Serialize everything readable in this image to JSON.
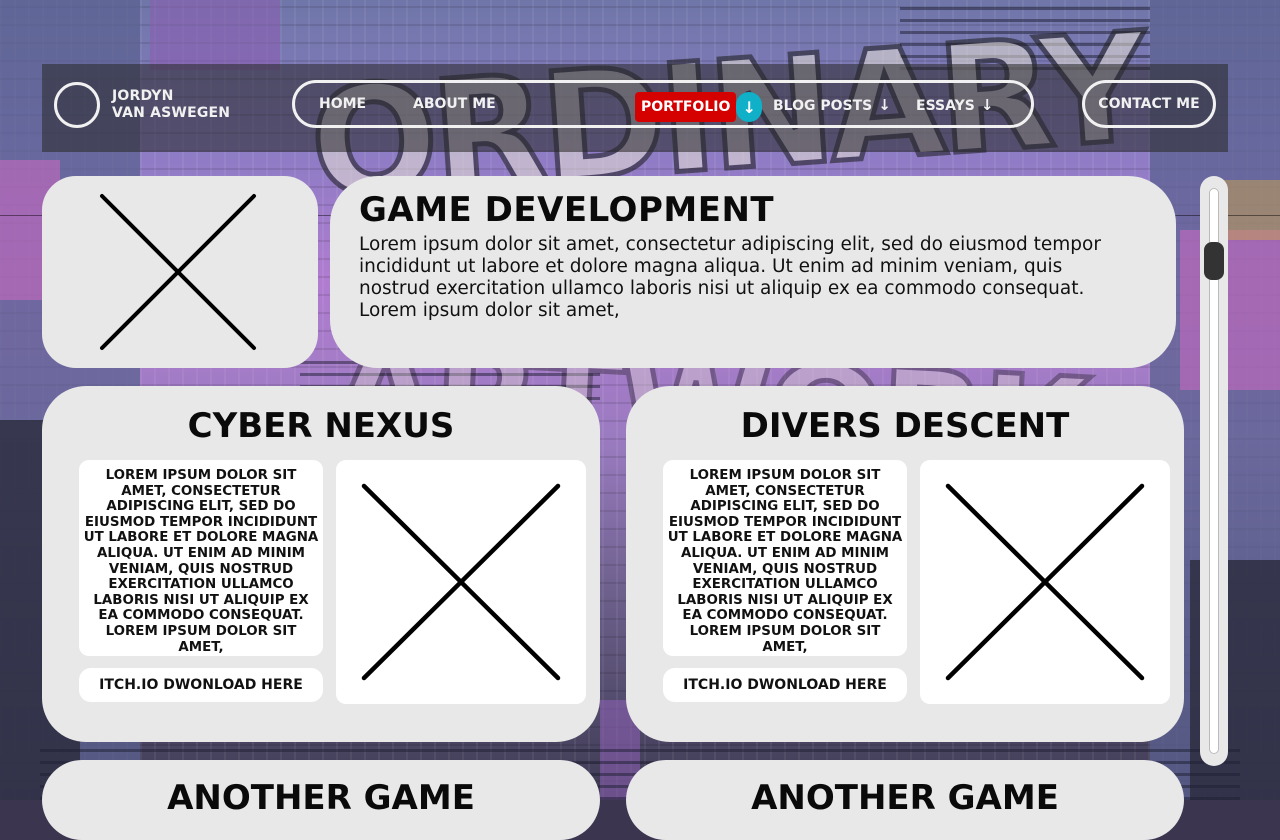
{
  "brand": {
    "name_line1": "JORDYN",
    "name_line2": "VAN ASWEGEN"
  },
  "nav": {
    "home": "HOME",
    "about": "ABOUT ME",
    "portfolio": "PORTFOLIO",
    "portfolio_arrow": "↓",
    "blog": "BLOG POSTS",
    "blog_arrow": "↓",
    "essays": "ESSAYS",
    "essays_arrow": "↓",
    "contact": "CONTACT ME",
    "active_color": "#d50000",
    "arrow_badge_color": "#0fb0c8"
  },
  "section": {
    "title": "GAME DEVELOPMENT",
    "body": "Lorem ipsum dolor sit amet, consectetur adipiscing elit, sed do eiusmod tempor incididunt ut labore et dolore magna aliqua. Ut enim ad minim veniam, quis nostrud exercitation ullamco laboris nisi ut aliquip ex ea commodo consequat. Lorem ipsum dolor sit amet,",
    "image_icon": "placeholder-x-icon"
  },
  "games": [
    {
      "title": "CYBER NEXUS",
      "description": "LOREM IPSUM DOLOR SIT AMET, CONSECTETUR ADIPISCING ELIT, SED DO EIUSMOD TEMPOR INCIDIDUNT UT LABORE ET DOLORE MAGNA ALIQUA. UT ENIM AD MINIM VENIAM, QUIS NOSTRUD EXERCITATION ULLAMCO LABORIS NISI UT ALIQUIP EX EA COMMODO CONSEQUAT. LOREM IPSUM DOLOR SIT AMET,",
      "link": "ITCH.IO DWONLOAD HERE"
    },
    {
      "title": "DIVERS DESCENT",
      "description": "LOREM IPSUM DOLOR SIT AMET, CONSECTETUR ADIPISCING ELIT, SED DO EIUSMOD TEMPOR INCIDIDUNT UT LABORE ET DOLORE MAGNA ALIQUA. UT ENIM AD MINIM VENIAM, QUIS NOSTRUD EXERCITATION ULLAMCO LABORIS NISI UT ALIQUIP EX EA COMMODO CONSEQUAT. LOREM IPSUM DOLOR SIT AMET,",
      "link": "ITCH.IO DWONLOAD HERE"
    }
  ],
  "more_games": [
    {
      "title": "ANOTHER GAME"
    },
    {
      "title": "ANOTHER GAME"
    }
  ],
  "colors": {
    "card_bg": "#e8e8e8",
    "nav_bg": "rgba(40,40,40,0.55)",
    "text": "#0a0a0a"
  }
}
